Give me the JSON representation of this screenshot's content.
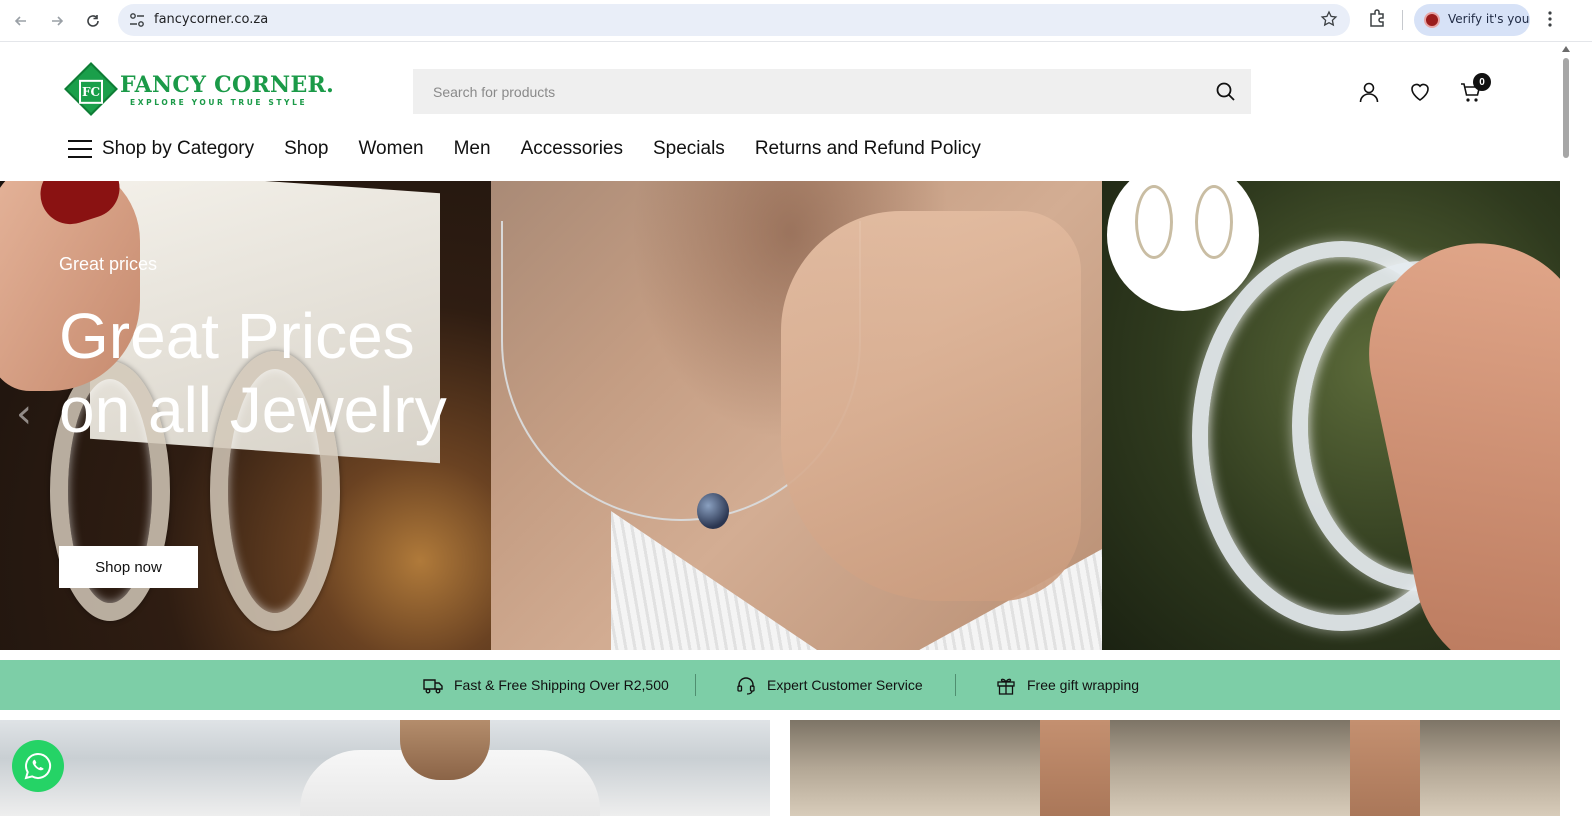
{
  "browser": {
    "url": "fancycorner.co.za",
    "profile_label": "Verify it's you",
    "icons": [
      "back-arrow-icon",
      "forward-arrow-icon",
      "reload-icon",
      "site-info-icon",
      "bookmark-star-icon",
      "extensions-icon",
      "menu-kebab-icon"
    ]
  },
  "header": {
    "logo_title": "FANCY CORNER.",
    "logo_tagline": "EXPLORE YOUR TRUE STYLE",
    "logo_monogram": "FC",
    "search_placeholder": "Search for products",
    "cart_count": "0",
    "brand_color": "#1b9a48"
  },
  "nav": {
    "category_label": "Shop by Category",
    "items": [
      "Shop",
      "Women",
      "Men",
      "Accessories",
      "Specials",
      "Returns and Refund Policy"
    ]
  },
  "hero": {
    "kicker": "Great prices",
    "title": "Great Prices on all Jewelry",
    "button_label": "Shop now",
    "prev_arrow": "‹"
  },
  "features": {
    "background": "#7dcea7",
    "items": [
      {
        "icon": "delivery-truck-icon",
        "label": "Fast & Free Shipping Over R2,500"
      },
      {
        "icon": "headset-icon",
        "label": "Expert Customer Service"
      },
      {
        "icon": "gift-icon",
        "label": "Free gift wrapping"
      }
    ]
  }
}
